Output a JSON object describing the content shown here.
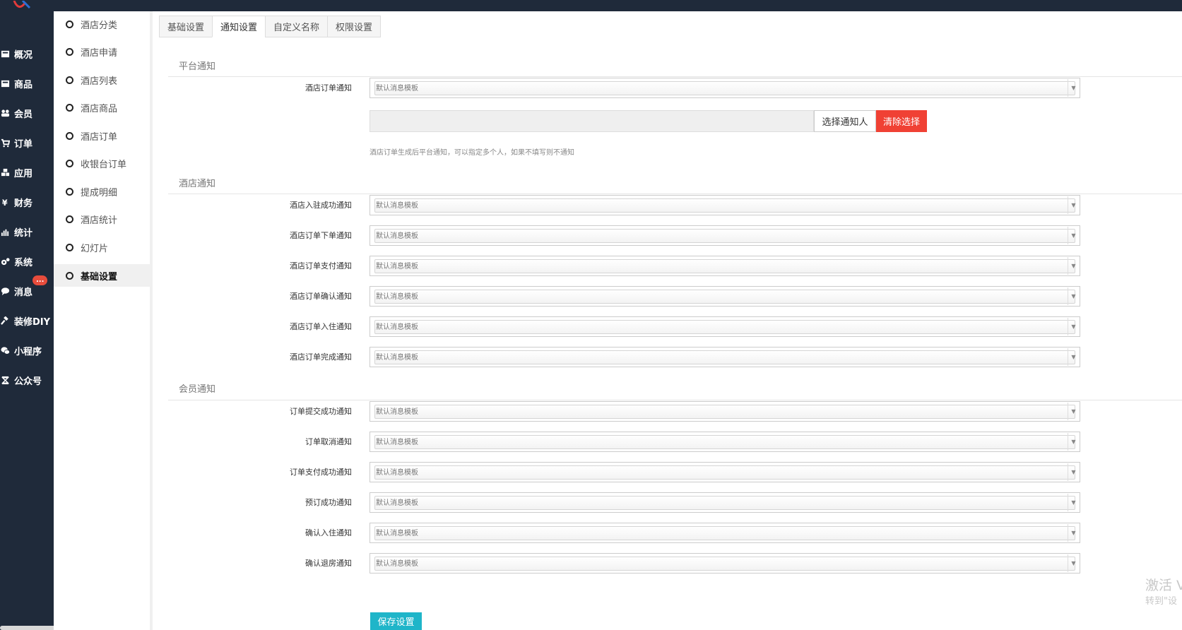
{
  "sidebar": {
    "items": [
      {
        "label": "概况",
        "icon": "monitor-icon"
      },
      {
        "label": "商品",
        "icon": "box-icon"
      },
      {
        "label": "会员",
        "icon": "users-icon"
      },
      {
        "label": "订单",
        "icon": "cart-icon"
      },
      {
        "label": "应用",
        "icon": "cubes-icon"
      },
      {
        "label": "财务",
        "icon": "yen-icon"
      },
      {
        "label": "统计",
        "icon": "bar-chart-icon"
      },
      {
        "label": "系统",
        "icon": "gears-icon"
      },
      {
        "label": "消息",
        "icon": "chat-icon",
        "badge": "..."
      },
      {
        "label": "装修DIY",
        "icon": "gavel-icon"
      },
      {
        "label": "小程序",
        "icon": "wechat-icon"
      },
      {
        "label": "公众号",
        "icon": "hourglass-icon"
      }
    ]
  },
  "subnav": {
    "items": [
      "酒店分类",
      "酒店申请",
      "酒店列表",
      "酒店商品",
      "酒店订单",
      "收银台订单",
      "提成明细",
      "酒店统计",
      "幻灯片",
      "基础设置"
    ],
    "active_index": 9
  },
  "tabs": [
    "基础设置",
    "通知设置",
    "自定义名称",
    "权限设置"
  ],
  "active_tab": 1,
  "select_default": "默认消息模板",
  "platform": {
    "title": "平台通知",
    "order_label": "酒店订单通知",
    "choose_button": "选择通知人",
    "clear_button": "清除选择",
    "help_text": "酒店订单生成后平台通知，可以指定多个人，如果不填写则不通知"
  },
  "hotel": {
    "title": "酒店通知",
    "rows": [
      "酒店入驻成功通知",
      "酒店订单下单通知",
      "酒店订单支付通知",
      "酒店订单确认通知",
      "酒店订单入住通知",
      "酒店订单完成通知"
    ]
  },
  "member": {
    "title": "会员通知",
    "rows": [
      "订单提交成功通知",
      "订单取消通知",
      "订单支付成功通知",
      "预订成功通知",
      "确认入住通知",
      "确认退房通知"
    ]
  },
  "save_button": "保存设置",
  "watermark": {
    "line1": "激活 V",
    "line2": "转到\"设"
  },
  "colors": {
    "sidebar_bg": "#1f2a3a",
    "danger": "#f04134",
    "primary": "#1fb5c9"
  }
}
